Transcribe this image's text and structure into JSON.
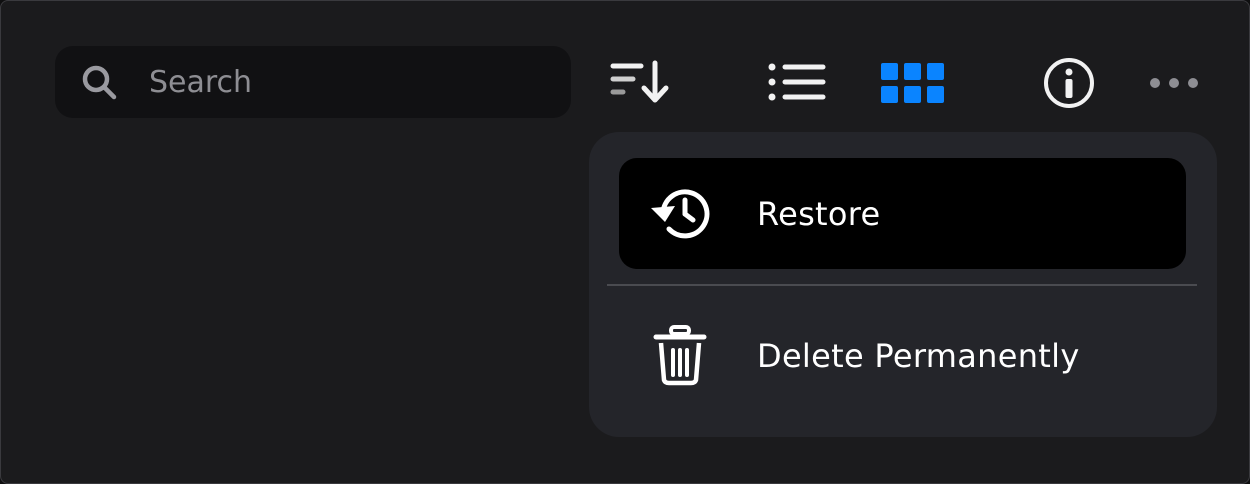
{
  "search": {
    "placeholder": "Search",
    "icon": "search-icon"
  },
  "toolbar": {
    "items": [
      {
        "name": "sort",
        "icon": "sort-descending-icon"
      },
      {
        "name": "list-view",
        "icon": "list-view-icon"
      },
      {
        "name": "grid-view",
        "icon": "grid-view-icon",
        "active": true
      },
      {
        "name": "info",
        "icon": "info-icon"
      },
      {
        "name": "more",
        "icon": "more-horizontal-icon"
      }
    ]
  },
  "context_menu": {
    "items": [
      {
        "label": "Restore",
        "icon": "restore-history-icon",
        "highlighted": true
      },
      {
        "label": "Delete Permanently",
        "icon": "trash-icon"
      }
    ]
  },
  "colors": {
    "background": "#1b1b1d",
    "menu_background": "#24252a",
    "highlight": "#000000",
    "accent": "#0a84ff",
    "muted": "#8e8e93"
  }
}
